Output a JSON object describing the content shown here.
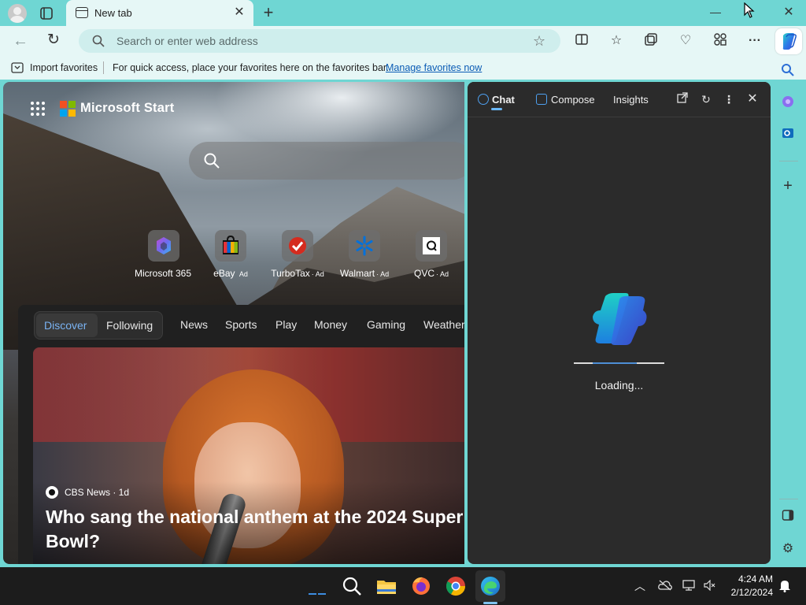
{
  "browser": {
    "tab_title": "New tab",
    "address_placeholder": "Search or enter web address"
  },
  "favorites_bar": {
    "import_label": "Import favorites",
    "message": "For quick access, place your favorites here on the favorites bar.",
    "manage_link": "Manage favorites now"
  },
  "start_page": {
    "brand": "Microsoft Start",
    "tiles": [
      {
        "label": "Microsoft 365",
        "ad": ""
      },
      {
        "label": "eBay",
        "ad": "Ad"
      },
      {
        "label": "TurboTax",
        "ad": "· Ad"
      },
      {
        "label": "Walmart",
        "ad": "· Ad"
      },
      {
        "label": "QVC",
        "ad": "· Ad"
      }
    ],
    "feed_tabs": {
      "discover": "Discover",
      "following": "Following",
      "categories": [
        "News",
        "Sports",
        "Play",
        "Money",
        "Gaming",
        "Weather"
      ]
    },
    "hero": {
      "source": "CBS News · 1d",
      "headline": "Who sang the national anthem at the 2024 Super Bowl?"
    }
  },
  "copilot_panel": {
    "tabs": {
      "chat": "Chat",
      "compose": "Compose",
      "insights": "Insights"
    },
    "loading_text": "Loading..."
  },
  "taskbar": {
    "time": "4:24 AM",
    "date": "2/12/2024"
  },
  "colors": {
    "chrome": "#6fd6d3",
    "toolbar": "#e6f7f6",
    "panel": "#2b2b2b",
    "accent": "#4e8fd6",
    "link": "#0a5bb5"
  }
}
